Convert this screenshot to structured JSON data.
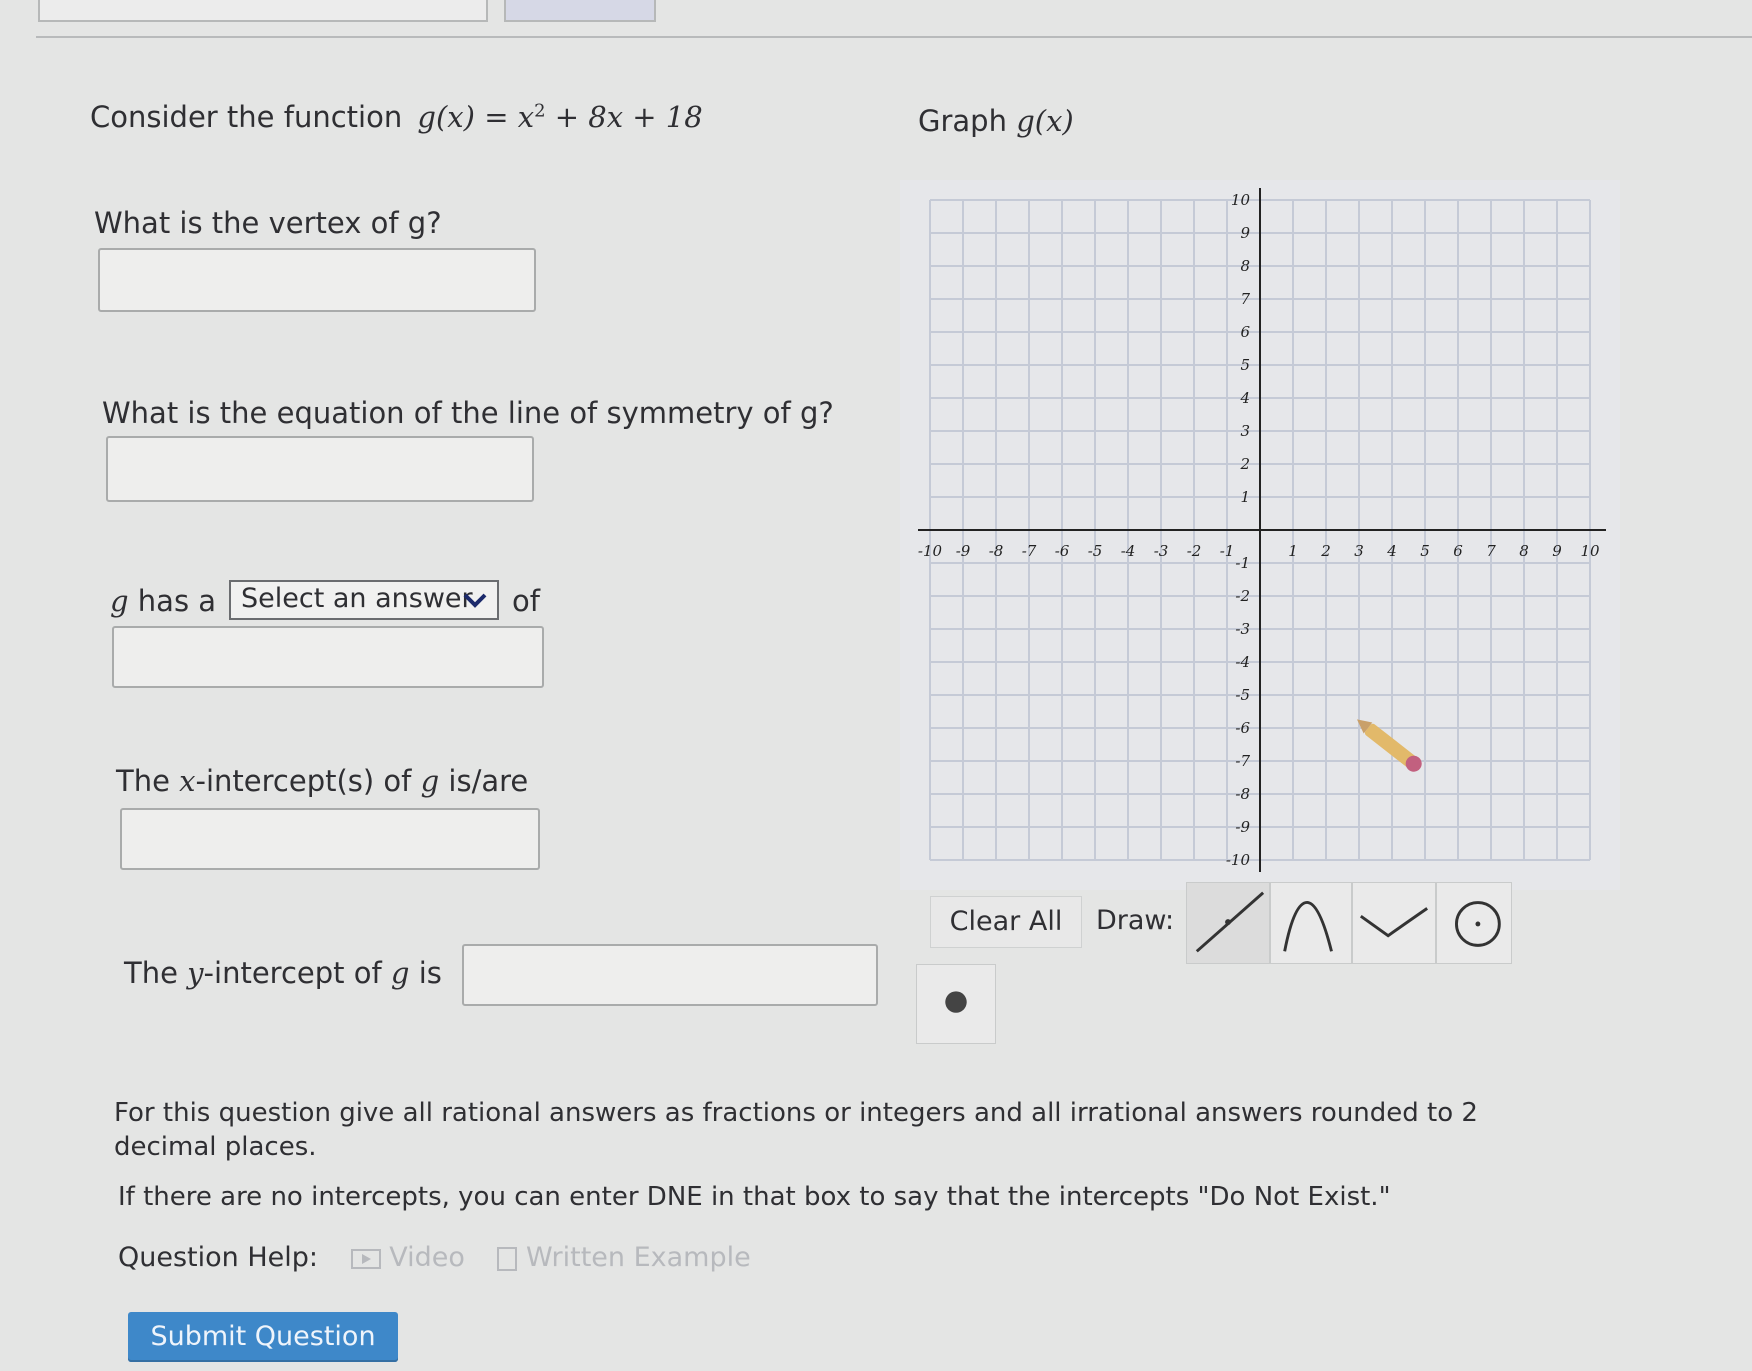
{
  "question": {
    "intro": "Consider the function",
    "function_lhs": "g(x)",
    "function_rhs_a": "= x",
    "function_exp": "2",
    "function_rhs_b": "+ 8x + 18",
    "graph_label": "Graph",
    "graph_fn": "g(x)"
  },
  "parts": {
    "vertex": {
      "label": "What is the vertex of g?",
      "value": ""
    },
    "symmetry": {
      "label": "What is the equation of the line of symmetry of g?",
      "value": ""
    },
    "extremum": {
      "prefix_var": "g",
      "prefix": "has a",
      "select_value": "Select an answer",
      "suffix": "of",
      "value": ""
    },
    "x_intercepts": {
      "label_a": "The",
      "label_var": "x",
      "label_b": "-intercept(s) of",
      "label_var2": "g",
      "label_c": "is/are",
      "value": ""
    },
    "y_intercept": {
      "label_a": "The",
      "label_var": "y",
      "label_b": "-intercept of",
      "label_var2": "g",
      "label_c": "is",
      "value": ""
    }
  },
  "graph": {
    "x_range": [
      -10,
      10
    ],
    "y_range": [
      -10,
      10
    ],
    "grid": true,
    "x_ticks": [
      "-10",
      "-9",
      "-8",
      "-7",
      "-6",
      "-5",
      "-4",
      "-3",
      "-2",
      "-1",
      "1",
      "2",
      "3",
      "4",
      "5",
      "6",
      "7",
      "8",
      "9",
      "10"
    ],
    "y_ticks": [
      "10",
      "9",
      "8",
      "7",
      "6",
      "5",
      "4",
      "3",
      "2",
      "1",
      "-1",
      "-2",
      "-3",
      "-4",
      "-5",
      "-6",
      "-7",
      "-8",
      "-9",
      "-10"
    ]
  },
  "tools": {
    "clear_label": "Clear All",
    "draw_label": "Draw:",
    "items": [
      "line-tool",
      "parabola-down-tool",
      "parabola-up-tool",
      "circle-tool",
      "point-tool"
    ]
  },
  "instructions": {
    "line1": "For this question give all rational answers as fractions or integers and all irrational answers rounded to 2",
    "line1b": "decimal places.",
    "line2": "If there are no intercepts, you can enter DNE in that box to say that the intercepts \"Do Not Exist.\""
  },
  "help": {
    "label": "Question Help:",
    "video": "Video",
    "written": "Written Example"
  },
  "submit_label": "Submit Question",
  "colors": {
    "submit": "#3e88c9",
    "grid": "#c5cad6",
    "axis": "#222"
  }
}
